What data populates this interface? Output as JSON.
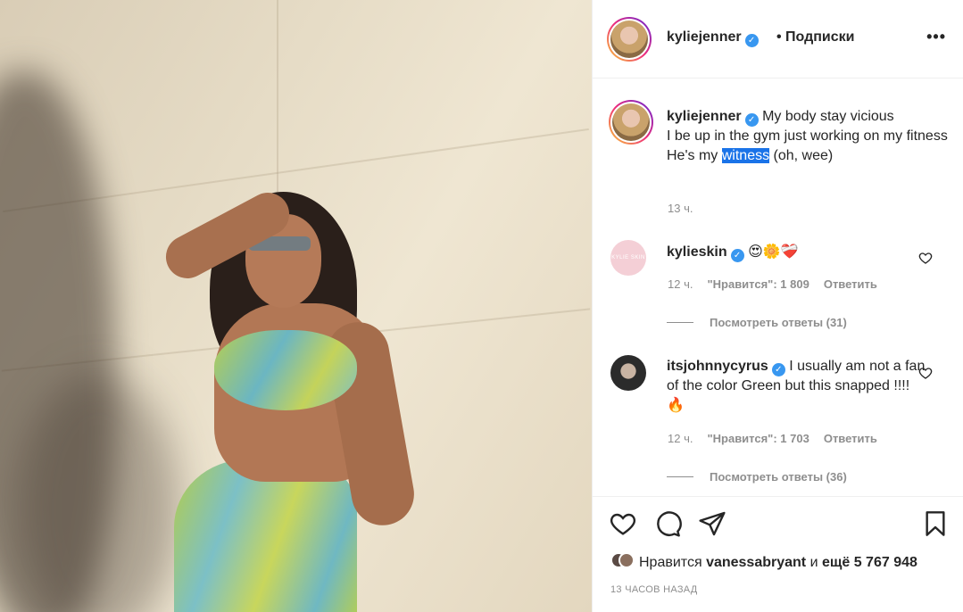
{
  "post": {
    "author": "kyliejenner",
    "follow_label": "• Подписки",
    "more_label": "•••"
  },
  "caption": {
    "author": "kyliejenner",
    "line1": "My body stay vicious",
    "line2": "I be up in the gym just working on my fitness",
    "line3_pre": "He's my ",
    "line3_highlight": "witness",
    "line3_post": " (oh, wee)",
    "time": "13 ч."
  },
  "comments": [
    {
      "author": "kylieskin",
      "avatar_text": "KYLIE SKIN",
      "text": "😍🌼❤️‍🩹",
      "time": "12 ч.",
      "likes": "\"Нравится\": 1 809",
      "reply": "Ответить",
      "view_replies": "Посмотреть ответы (31)"
    },
    {
      "author": "itsjohnnycyrus",
      "text": "I usually am not a fan of the color Green but this snapped !!!! 🔥",
      "time": "12 ч.",
      "likes": "\"Нравится\": 1 703",
      "reply": "Ответить",
      "view_replies": "Посмотреть ответы (36)"
    }
  ],
  "likes": {
    "prefix": "Нравится",
    "user": "vanessabryant",
    "middle": "и",
    "count": "ещё 5 767 948"
  },
  "post_time": "13 ЧАСОВ НАЗАД",
  "icons": {
    "verified": "verified-badge-icon",
    "like": "heart-icon",
    "comment": "comment-icon",
    "share": "paper-plane-icon",
    "save": "bookmark-icon"
  },
  "colors": {
    "verified": "#3897f0",
    "highlight": "#1a73e8",
    "muted": "#8e8e8e"
  }
}
